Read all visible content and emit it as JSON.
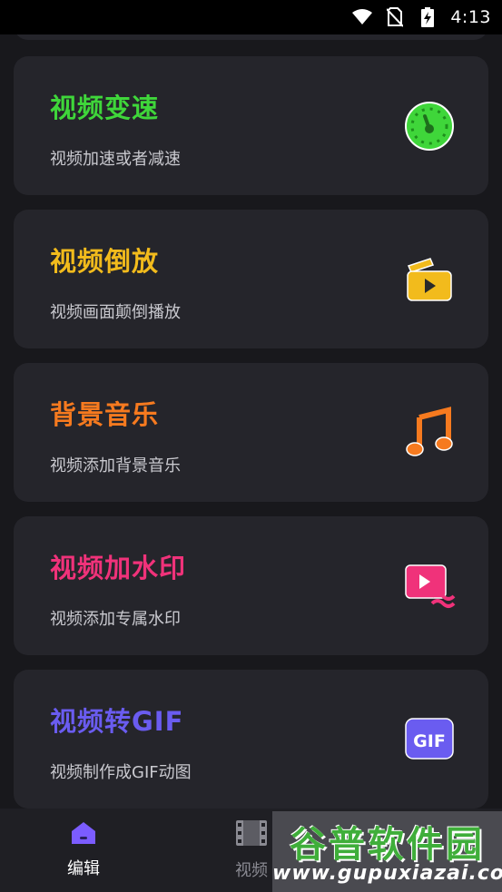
{
  "status_bar": {
    "time": "4:13",
    "icons": [
      "wifi-icon",
      "no-sim-icon",
      "battery-charging-icon"
    ]
  },
  "cards": [
    {
      "title": "视频变速",
      "subtitle": "视频加速或者减速",
      "title_color": "#3fd63a",
      "icon": "speedometer-icon"
    },
    {
      "title": "视频倒放",
      "subtitle": "视频画面颠倒播放",
      "title_color": "#f2bb1c",
      "icon": "reverse-play-icon"
    },
    {
      "title": "背景音乐",
      "subtitle": "视频添加背景音乐",
      "title_color": "#f67a1f",
      "icon": "music-note-icon"
    },
    {
      "title": "视频加水印",
      "subtitle": "视频添加专属水印",
      "title_color": "#f0327a",
      "icon": "watermark-icon"
    },
    {
      "title": "视频转GIF",
      "subtitle": "视频制作成GIF动图",
      "title_color": "#6a5cf0",
      "icon": "gif-icon",
      "icon_text": "GIF"
    }
  ],
  "bottom_nav": {
    "tabs": [
      {
        "label": "编辑",
        "icon": "home-icon",
        "active": true
      },
      {
        "label": "视频",
        "icon": "film-icon",
        "active": false
      }
    ],
    "active_color": "#7b5cff",
    "inactive_color": "#8a8a92"
  },
  "watermark": {
    "text_top": "谷普软件园",
    "text_bottom": "www.gupuxiazai.com"
  }
}
